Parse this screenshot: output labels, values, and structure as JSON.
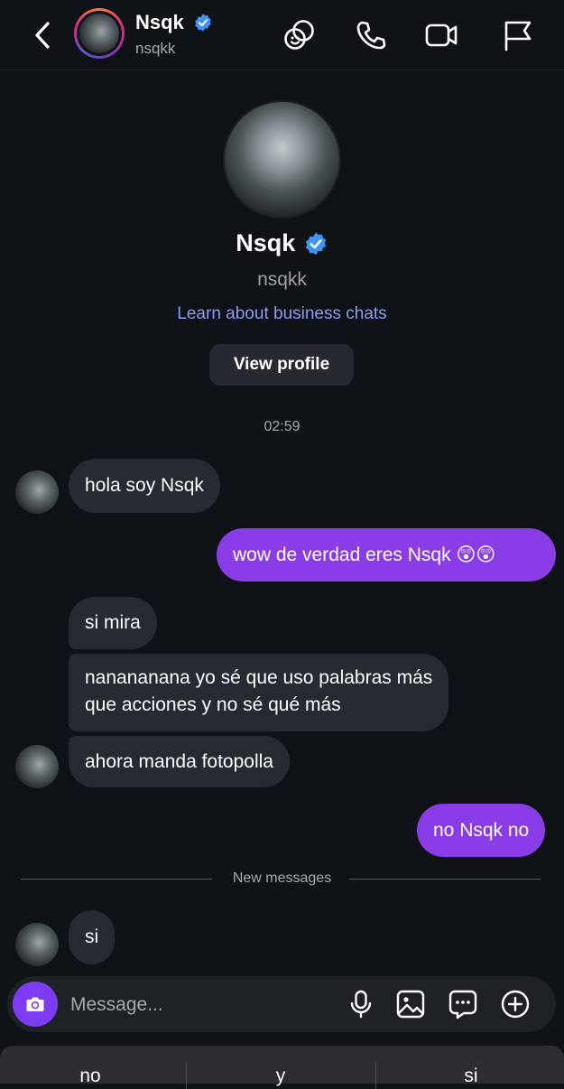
{
  "header": {
    "name": "Nsqk",
    "handle": "nsqkk",
    "icons": [
      "chevron-left-icon",
      "avatar",
      "verified-badge-icon",
      "stickers-icon",
      "phone-icon",
      "video-camera-icon",
      "flag-icon"
    ]
  },
  "profile": {
    "name": "Nsqk",
    "handle": "nsqkk",
    "learn_link": "Learn about business chats",
    "view_profile_label": "View profile"
  },
  "timestamp": "02:59",
  "messages": [
    {
      "direction": "in",
      "text": "hola soy Nsqk"
    },
    {
      "direction": "out",
      "text": "wow de verdad eres Nsqk 😲😲"
    },
    {
      "direction": "in",
      "text": "si mira"
    },
    {
      "direction": "in",
      "lines": [
        "nanananana yo sé que uso palabras más",
        "que acciones y no sé qué más"
      ]
    },
    {
      "direction": "in",
      "text": "ahora manda fotopolla"
    },
    {
      "direction": "out",
      "text": "no Nsqk no"
    },
    {
      "direction": "in",
      "text": "si"
    }
  ],
  "new_messages_label": "New messages",
  "composer": {
    "placeholder": "Message...",
    "icons": [
      "camera-icon",
      "microphone-icon",
      "image-icon",
      "sticker-chat-icon",
      "plus-icon"
    ]
  },
  "keyboard_suggestions": [
    "no",
    "y",
    "si"
  ],
  "colors": {
    "background": "#0f1217",
    "incoming_bubble": "#262a31",
    "outgoing_bubble": "#8a3ce6",
    "link": "#8c9cf0",
    "verified": "#3f93f5"
  }
}
